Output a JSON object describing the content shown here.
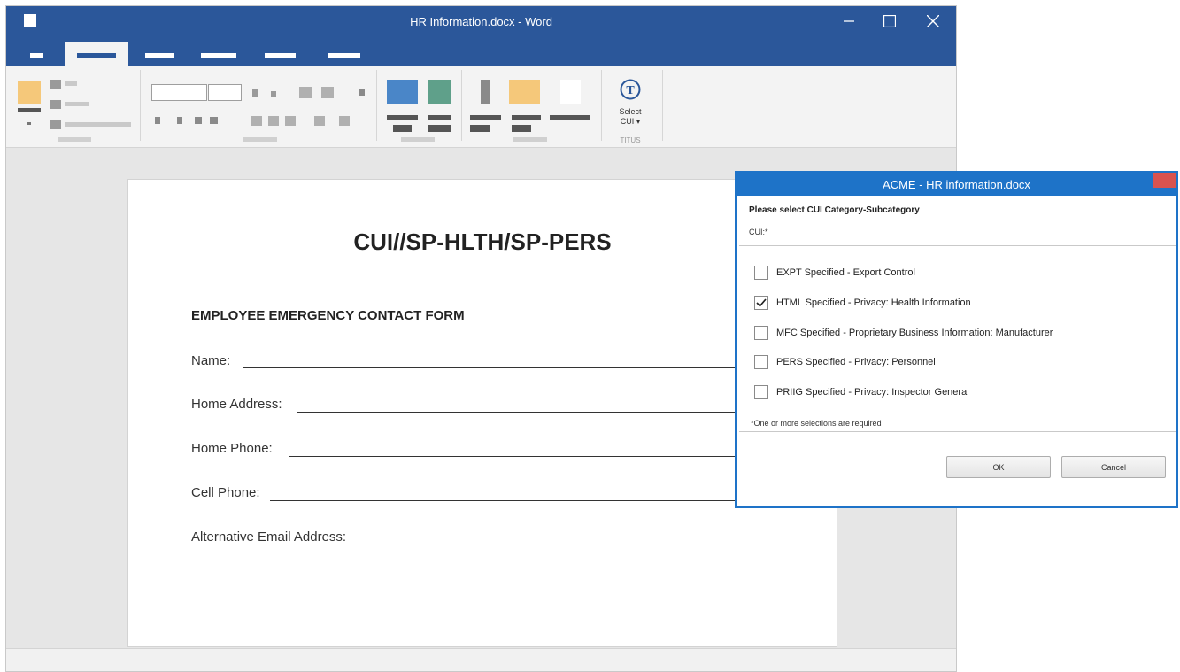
{
  "window": {
    "title": "HR Information.docx - Word"
  },
  "ribbon": {
    "titus_button": {
      "line1": "Select",
      "line2": "CUI ▾"
    },
    "titus_group_label": "TITUS",
    "titus_icon_letter": "T"
  },
  "document": {
    "title": "CUI//SP-HLTH/SP-PERS",
    "form_heading": "EMPLOYEE EMERGENCY CONTACT FORM",
    "fields": [
      {
        "label": "Name:"
      },
      {
        "label": "Home Address:"
      },
      {
        "label": "Home Phone:"
      },
      {
        "label": "Cell Phone:"
      },
      {
        "label": "Alternative Email Address:"
      }
    ]
  },
  "dialog": {
    "title": "ACME - HR information.docx",
    "heading": "Please select CUI Category-Subcategory",
    "cui_label": "CUI:*",
    "options": [
      {
        "label": "EXPT Specified - Export Control",
        "checked": false
      },
      {
        "label": "HTML Specified - Privacy: Health Information",
        "checked": true
      },
      {
        "label": "MFC Specified - Proprietary Business Information: Manufacturer",
        "checked": false
      },
      {
        "label": "PERS Specified - Privacy: Personnel",
        "checked": false
      },
      {
        "label": "PRIIG Specified - Privacy: Inspector General",
        "checked": false
      }
    ],
    "note": "*One or more selections are required",
    "ok_label": "OK",
    "cancel_label": "Cancel"
  },
  "colors": {
    "word_blue": "#2b579a",
    "dialog_blue": "#1e73c8",
    "close_red": "#d9534f"
  },
  "icons": [
    "minimize-icon",
    "maximize-icon",
    "close-icon",
    "titus-icon",
    "checkmark-icon"
  ]
}
